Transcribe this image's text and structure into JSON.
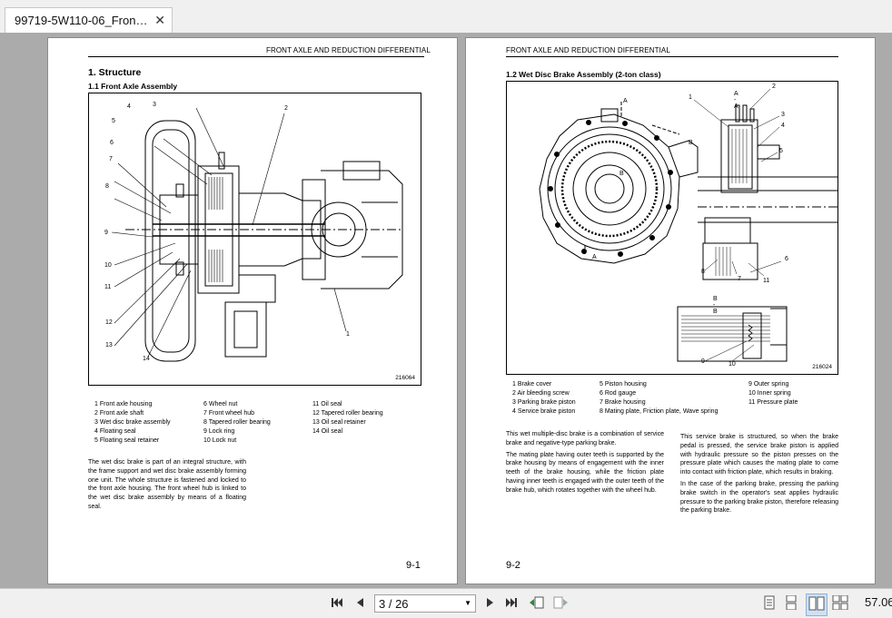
{
  "tab": {
    "title": "99719-5W110-06_Fron…"
  },
  "pages": {
    "left": {
      "header": "FRONT AXLE AND REDUCTION DIFFERENTIAL",
      "h1": "1.  Structure",
      "h2": "1.1   Front Axle Assembly",
      "fig_id": "216064",
      "callouts": [
        "1",
        "2",
        "3",
        "4",
        "5",
        "6",
        "7",
        "8",
        "9",
        "10",
        "11",
        "12",
        "13",
        "14"
      ],
      "legend_col1": [
        "1  Front axle housing",
        "2  Front axle shaft",
        "3  Wet disc brake assembly",
        "4  Floating seal",
        "5  Floating seal retainer"
      ],
      "legend_col2": [
        "6  Wheel nut",
        "7  Front wheel hub",
        "8  Tapered roller bearing",
        "9  Lock ring",
        "10 Lock nut"
      ],
      "legend_col3": [
        "11 Oil seal",
        "12 Tapered roller bearing",
        "13 Oil seal retainer",
        "14 Oil seal"
      ],
      "para": "The wet disc brake is part of an integral structure, with the frame support and wet disc brake assembly forming one unit. The whole structure is fastened and locked to the front axle housing. The front wheel hub is linked to the wet disc brake assembly by means of a floating seal.",
      "page_number": "9-1"
    },
    "right": {
      "header": "FRONT AXLE AND REDUCTION DIFFERENTIAL",
      "h2": "1.2   Wet Disc Brake Assembly (2-ton class)",
      "fig_id": "216024",
      "section_aa": "A - A",
      "section_bb": "B - B",
      "marker_a": "A",
      "marker_b": "B",
      "callouts": [
        "1",
        "2",
        "3",
        "4",
        "5",
        "6",
        "7",
        "8",
        "9",
        "10",
        "11"
      ],
      "legend_col1": [
        "1  Brake cover",
        "2  Air bleeding screw",
        "3  Parking brake piston",
        "4  Service brake piston"
      ],
      "legend_col2": [
        "5  Piston housing",
        "6  Rod gauge",
        "7  Brake housing",
        "8  Mating plate, Friction plate, Wave spring"
      ],
      "legend_col3": [
        "9  Outer spring",
        "10 Inner spring",
        "11 Pressure plate"
      ],
      "para_left": [
        "This wet multiple-disc brake is a combination of service brake and negative-type parking brake.",
        "The mating plate having outer teeth is supported by the brake housing by means of engagement with the inner teeth of the brake housing, while the friction plate having inner teeth is engaged with the outer teeth of the brake hub, which rotates together with the wheel hub."
      ],
      "para_right": [
        "This service brake is structured, so when the brake pedal is pressed, the service brake piston is applied with hydraulic pressure so the piston presses on the pressure plate which causes the mating plate to come into contact with friction plate, which results in braking.",
        "In the case of the parking brake, pressing the parking brake switch in the operator's seat applies hydraulic pressure to the parking brake piston, therefore releasing the parking brake."
      ],
      "page_number": "9-2"
    }
  },
  "toolbar": {
    "first_icon": "first-page-icon",
    "prev_icon": "previous-page-icon",
    "page_value": "3 / 26",
    "next_icon": "next-page-icon",
    "last_icon": "last-page-icon",
    "zoom": "57.06"
  }
}
